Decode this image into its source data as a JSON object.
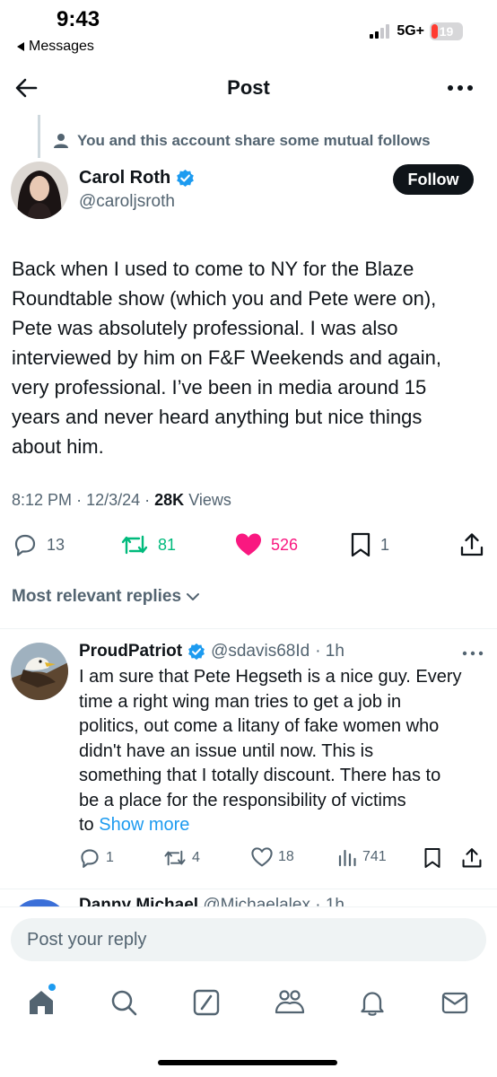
{
  "status_bar": {
    "time": "9:43",
    "back_app": "Messages",
    "network": "5G+",
    "battery": "19",
    "battery_level": 0.19
  },
  "header": {
    "title": "Post"
  },
  "context": {
    "text": "You and this account share some mutual follows"
  },
  "author": {
    "name": "Carol Roth",
    "handle": "@caroljsroth",
    "verified": true,
    "follow_label": "Follow"
  },
  "post": {
    "text": "Back when I used to come to NY for the Blaze\nRoundtable show (which you and Pete were on),\nPete was absolutely professional. I was also\ninterviewed by him on  F&F Weekends and again,\nvery professional. I’ve been in media around 15\nyears and never heard anything but nice things\nabout him.",
    "time": "8:12 PM",
    "date": "12/3/24",
    "views_count": "28K",
    "views_label": "Views"
  },
  "actions": {
    "replies": "13",
    "reposts": "81",
    "likes": "526",
    "bookmarks": "1"
  },
  "replies_sort": {
    "label": "Most relevant replies"
  },
  "reply": {
    "name": "ProudPatriot",
    "handle": "@sdavis68Id",
    "time": "· 1h",
    "verified": true,
    "text": "I am sure that Pete Hegseth is a nice guy.  Every\ntime a right wing man tries to get a job in\npolitics, out come a litany of fake women who\ndidn't have an issue until now.  This is\nsomething that I totally discount.  There has to\nbe a place for the responsibility of victims\nto ",
    "show_more": "Show more",
    "replies": "1",
    "reposts": "4",
    "likes": "18",
    "views": "741"
  },
  "next_reply": {
    "name": "Danny Michael",
    "handle": "@Michaelalex · 1h"
  },
  "compose": {
    "placeholder": "Post your reply"
  },
  "colors": {
    "accent": "#1d9bf0",
    "repost": "#00ba7c",
    "like": "#f91880",
    "secondary_text": "#536471",
    "battery_low": "#ff3b30"
  },
  "icons": [
    "back-arrow-icon",
    "more-icon",
    "person-icon",
    "verified-badge-icon",
    "reply-icon",
    "repost-icon",
    "like-icon",
    "bookmark-icon",
    "share-icon",
    "chevron-down-icon",
    "views-icon",
    "home-icon",
    "search-icon",
    "grok-icon",
    "communities-icon",
    "notifications-icon",
    "messages-icon"
  ]
}
